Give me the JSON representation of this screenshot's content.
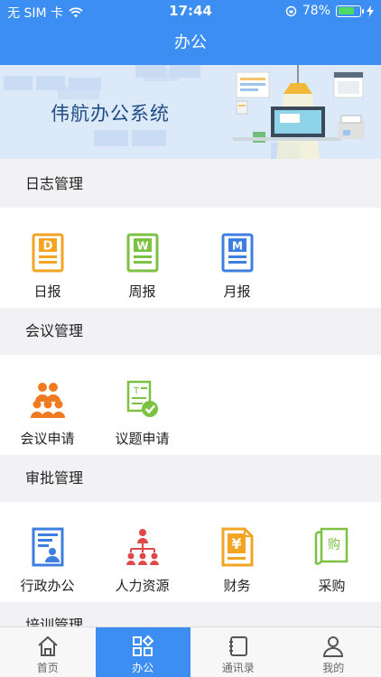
{
  "status_bar": {
    "carrier": "无 SIM 卡",
    "time": "17:44",
    "battery": "78%",
    "battery_level": 0.78
  },
  "header": {
    "title": "办公"
  },
  "banner": {
    "title": "伟航办公系统"
  },
  "sections": [
    {
      "title": "日志管理",
      "items": [
        {
          "label": "日报",
          "icon": "daily-report-icon",
          "letter": "D",
          "color": "#f2a422"
        },
        {
          "label": "周报",
          "icon": "weekly-report-icon",
          "letter": "W",
          "color": "#7cc242"
        },
        {
          "label": "月报",
          "icon": "monthly-report-icon",
          "letter": "M",
          "color": "#3c7fe0"
        }
      ]
    },
    {
      "title": "会议管理",
      "items": [
        {
          "label": "会议申请",
          "icon": "meeting-request-icon",
          "color": "#f07a22"
        },
        {
          "label": "议题申请",
          "icon": "topic-request-icon",
          "color": "#7cc242"
        }
      ]
    },
    {
      "title": "审批管理",
      "items": [
        {
          "label": "行政办公",
          "icon": "administration-icon",
          "color": "#3c7fe0"
        },
        {
          "label": "人力资源",
          "icon": "human-resources-icon",
          "color": "#e04848"
        },
        {
          "label": "财务",
          "icon": "finance-icon",
          "symbol": "¥",
          "color": "#f2a422"
        },
        {
          "label": "采购",
          "icon": "purchase-icon",
          "symbol": "购",
          "color": "#7cc242"
        }
      ]
    },
    {
      "title": "培训管理"
    }
  ],
  "tabbar": [
    {
      "label": "首页",
      "icon": "home-icon"
    },
    {
      "label": "办公",
      "icon": "office-grid-icon",
      "active": true
    },
    {
      "label": "通讯录",
      "icon": "contacts-icon"
    },
    {
      "label": "我的",
      "icon": "profile-icon"
    }
  ],
  "colors": {
    "primary": "#3c8ef3",
    "background": "#f2f2f4"
  }
}
